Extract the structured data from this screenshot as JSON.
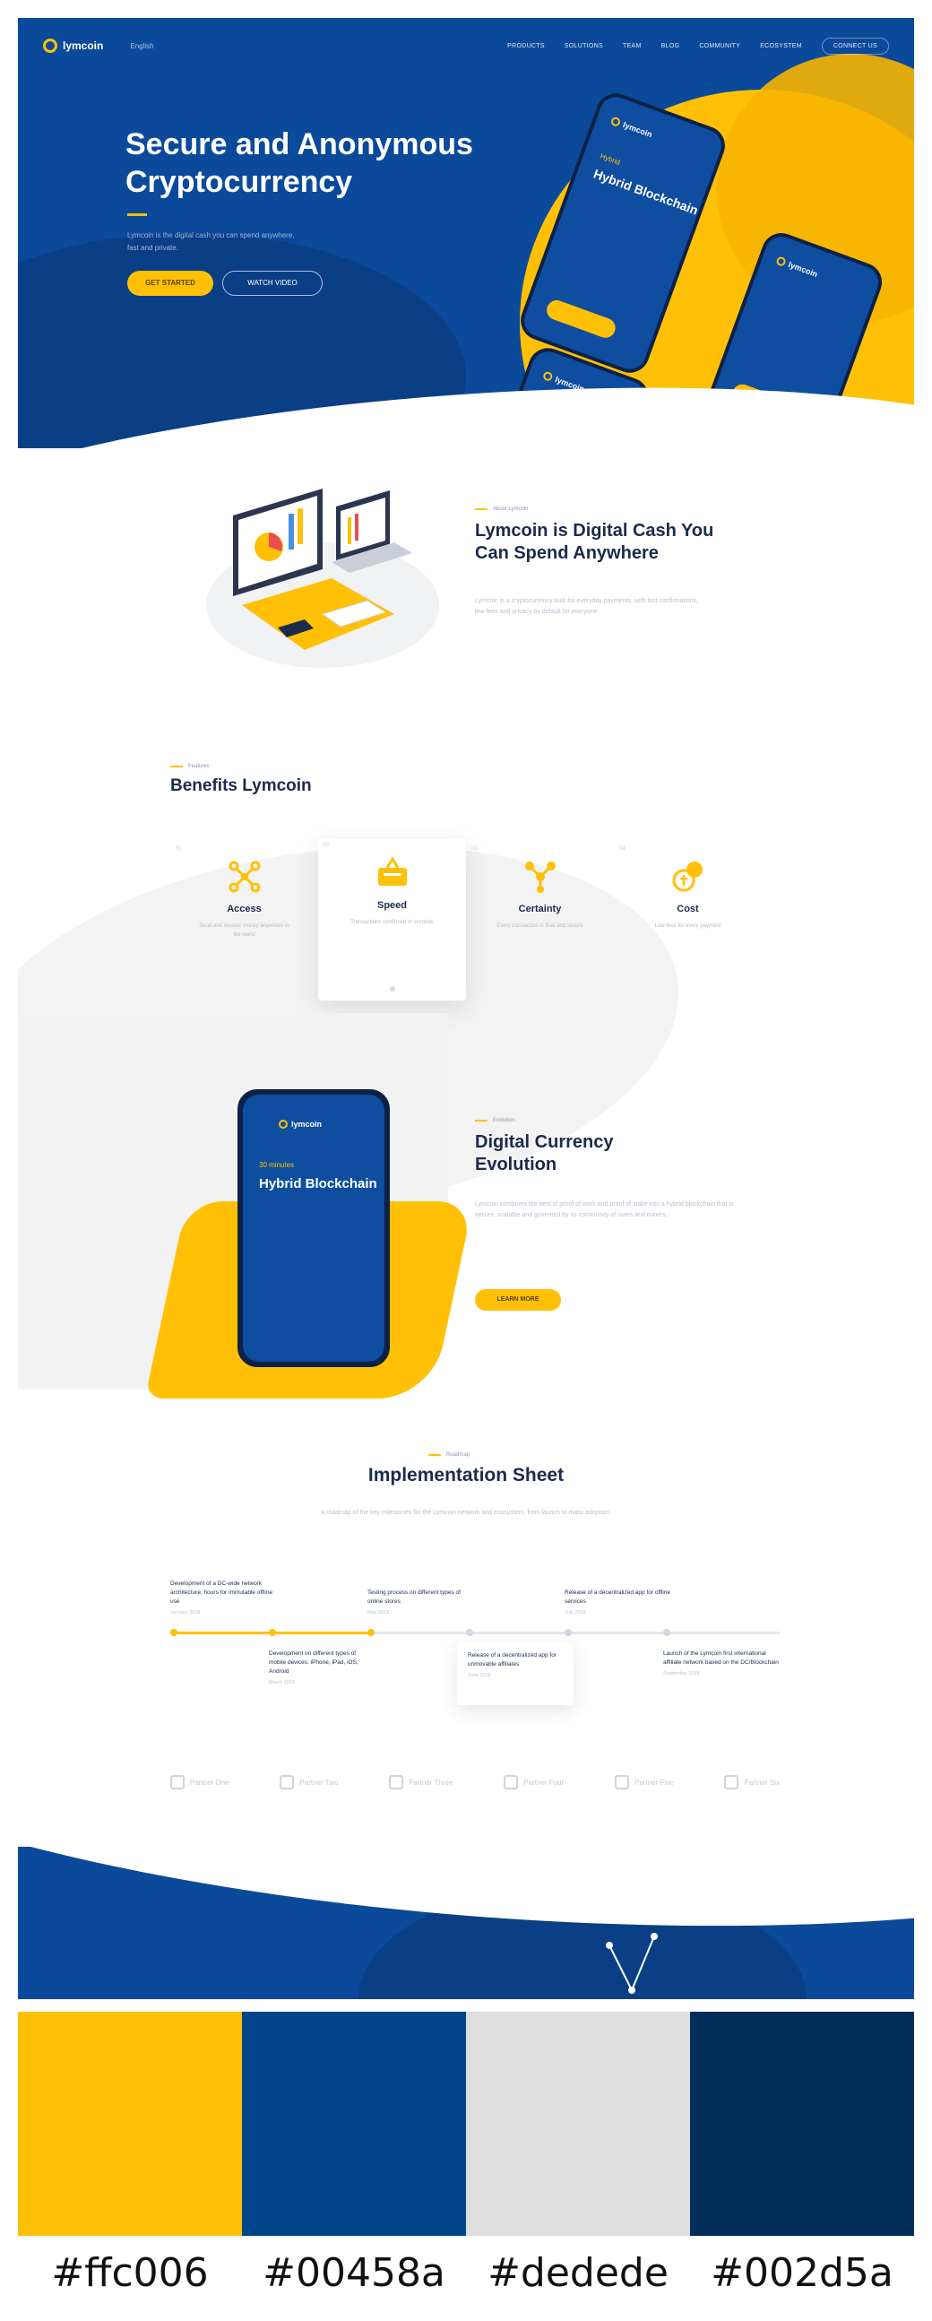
{
  "nav": {
    "logo_text": "lymcoin",
    "lang": "English",
    "items": [
      "PRODUCTS",
      "SOLUTIONS",
      "TEAM",
      "BLOG",
      "COMMUNITY",
      "ECOSYSTEM"
    ],
    "cta": "CONNECT US"
  },
  "hero": {
    "title": "Secure and Anonymous Cryptocurrency",
    "subtitle": "Lymcoin is the digital cash you can spend anywhere, fast and private.",
    "primary_button": "GET STARTED",
    "secondary_button": "WATCH VIDEO"
  },
  "hero_phones": {
    "logo": "lymcoin",
    "screen_small": "Hybrid",
    "screen_title": "Hybrid Blockchain"
  },
  "about": {
    "eyebrow": "About Lymcoin",
    "title": "Lymcoin is Digital Cash You Can Spend Anywhere",
    "text": "Lymcoin is a cryptocurrency built for everyday payments, with fast confirmations, low fees and privacy by default for everyone."
  },
  "benefits": {
    "eyebrow": "Features",
    "title": "Benefits Lymcoin",
    "cards": [
      {
        "num": "01",
        "title": "Access",
        "desc": "Send and receive money anywhere in the world",
        "icon": "network-icon"
      },
      {
        "num": "02",
        "title": "Speed",
        "desc": "Transactions confirmed in seconds",
        "icon": "speed-icon"
      },
      {
        "num": "03",
        "title": "Certainty",
        "desc": "Every transaction is final and secure",
        "icon": "nodes-icon"
      },
      {
        "num": "04",
        "title": "Cost",
        "desc": "Low fees for every payment",
        "icon": "coins-icon"
      }
    ]
  },
  "evolution": {
    "eyebrow": "Evolution",
    "title": "Digital Currency Evolution",
    "text": "Lymcoin combines the best of proof of work and proof of stake into a hybrid blockchain that is secure, scalable and governed by its community of users and miners.",
    "button": "LEARN MORE",
    "phone_small": "30 minutes",
    "phone_title": "Hybrid Blockchain",
    "phone_logo": "lymcoin"
  },
  "implementation": {
    "eyebrow": "Roadmap",
    "title": "Implementation Sheet",
    "text": "A roadmap of the key milestones for the Lymcoin network and ecosystem, from launch to mass adoption.",
    "top_items": [
      {
        "text": "Development of a DC-wide network architecture, hours for immutable offline use",
        "date": "January 2018"
      },
      {
        "text": "Testing process on different types of online stores",
        "date": "May 2018"
      },
      {
        "text": "Release of a decentralized app for offline services",
        "date": "July 2018"
      }
    ],
    "bottom_items": [
      {
        "text": "Development on different types of mobile devices: iPhone, iPad, iOS, Android",
        "date": "March 2018"
      },
      {
        "text": "Release of a decentralized app for unmovable affiliates",
        "date": "June 2018"
      },
      {
        "text": "Launch of the Lymcoin first international affiliate network based on the DC/Blockchain",
        "date": "September 2018"
      }
    ]
  },
  "partners": [
    "Partner One",
    "Partner Two",
    "Partner Three",
    "Partner Four",
    "Partner Five",
    "Partner Six"
  ],
  "palette": {
    "colors": [
      "#ffc006",
      "#00458a",
      "#dedede",
      "#002d5a"
    ],
    "labels": [
      "#ffc006",
      "#00458a",
      "#dedede",
      "#002d5a"
    ]
  }
}
